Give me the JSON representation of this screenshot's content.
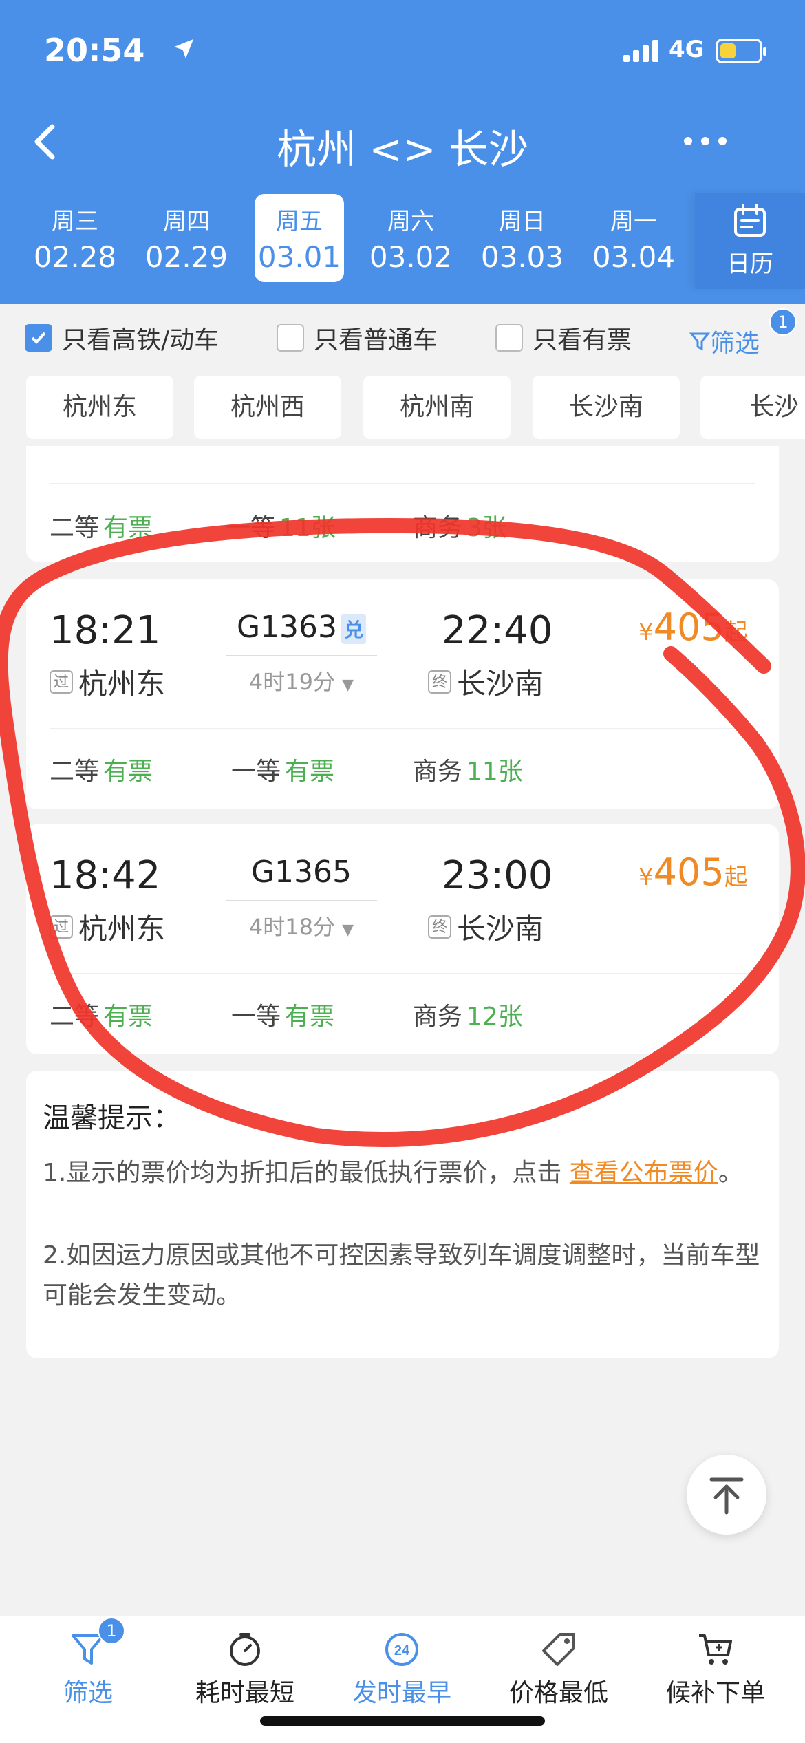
{
  "status_bar": {
    "time": "20:54",
    "network": "4G"
  },
  "nav": {
    "title": "杭州 <> 长沙"
  },
  "dates": [
    {
      "weekday": "周三",
      "date": "02.28"
    },
    {
      "weekday": "周四",
      "date": "02.29"
    },
    {
      "weekday": "周五",
      "date": "03.01",
      "active": true
    },
    {
      "weekday": "周六",
      "date": "03.02"
    },
    {
      "weekday": "周日",
      "date": "03.03"
    },
    {
      "weekday": "周一",
      "date": "03.04"
    }
  ],
  "calendar_label": "日历",
  "filters": {
    "high_speed": "只看高铁/动车",
    "normal": "只看普通车",
    "available": "只看有票",
    "filter": "筛选",
    "filter_count": "1"
  },
  "stations": [
    "杭州东",
    "杭州西",
    "杭州南",
    "长沙南",
    "长沙"
  ],
  "partial_card": {
    "seat1": "二等",
    "seat1v": "有票",
    "seat2": "一等",
    "seat2v": "11张",
    "seat3": "商务",
    "seat3v": "3张"
  },
  "trains": [
    {
      "dep": "18:21",
      "dep_tag": "过",
      "dep_station": "杭州东",
      "train": "G1363",
      "badge": "兑",
      "duration": "4时19分",
      "arr": "22:40",
      "arr_tag": "终",
      "arr_station": "长沙南",
      "price_symbol": "¥",
      "price": "405",
      "price_suffix": "起",
      "seats": [
        {
          "class": "二等",
          "avail": "有票"
        },
        {
          "class": "一等",
          "avail": "有票"
        },
        {
          "class": "商务",
          "avail": "11张"
        }
      ]
    },
    {
      "dep": "18:42",
      "dep_tag": "过",
      "dep_station": "杭州东",
      "train": "G1365",
      "duration": "4时18分",
      "arr": "23:00",
      "arr_tag": "终",
      "arr_station": "长沙南",
      "price_symbol": "¥",
      "price": "405",
      "price_suffix": "起",
      "seats": [
        {
          "class": "二等",
          "avail": "有票"
        },
        {
          "class": "一等",
          "avail": "有票"
        },
        {
          "class": "商务",
          "avail": "12张"
        }
      ]
    }
  ],
  "tips": {
    "title": "温馨提示：",
    "line1_a": "1.显示的票价均为折扣后的最低执行票价，点击 ",
    "line1_link": "查看公布票价",
    "line1_b": "。",
    "line2": "2.如因运力原因或其他不可控因素导致列车调度调整时，当前车型可能会发生变动。"
  },
  "bottom": {
    "filter": "筛选",
    "filter_badge": "1",
    "shortest": "耗时最短",
    "earliest": "发时最早",
    "earliest_icon_text": "24",
    "cheapest": "价格最低",
    "waitlist": "候补下单"
  },
  "colors": {
    "brand": "#4a90e8",
    "price": "#f08a24",
    "available": "#4caf50",
    "annotation": "#f0342a"
  }
}
